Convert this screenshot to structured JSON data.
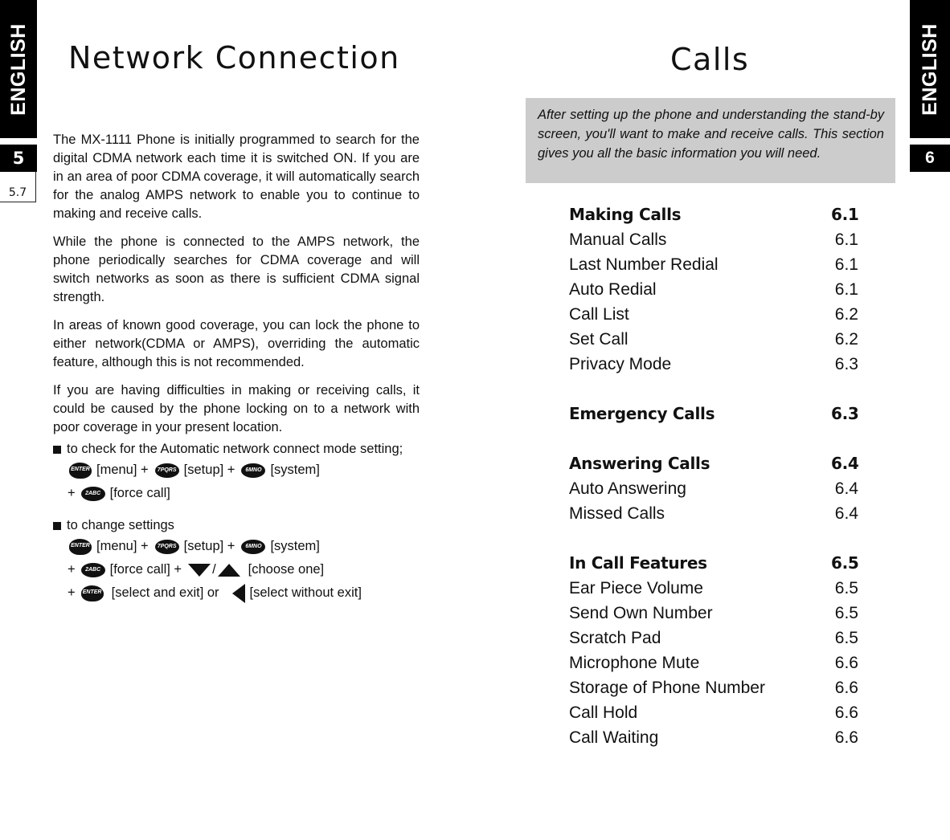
{
  "left_page": {
    "side_tab": {
      "language": "ENGLISH",
      "chapter": "5",
      "section": "5.7"
    },
    "title": "Network Connection",
    "paragraphs": [
      "The MX-1111 Phone is initially programmed to search for the digital CDMA network each time it is switched ON. If you are in an area of poor CDMA coverage, it will automatically search for the analog AMPS network to enable you to continue to making and receive calls.",
      "While the phone is connected to the AMPS network, the phone periodically searches for CDMA coverage and will switch networks as soon as there is sufficient CDMA signal strength.",
      "In areas of known good coverage, you can lock the phone to either network(CDMA or AMPS), overriding the automatic feature, although this is not recommended.",
      "If you are having difficulties in making or receiving calls, it could be caused by the phone locking on to a network with poor coverage in your present location."
    ],
    "check_mode": {
      "bullet": "to check for the Automatic network connect mode setting;",
      "keys": {
        "enter": "ENTER",
        "menu": "[menu] +",
        "seven": "7PQRS",
        "setup": "[setup] +",
        "six": "6MNO",
        "system": "[system]",
        "plus": "+",
        "two": "2ABC",
        "force_call": "[force call]"
      }
    },
    "change_settings": {
      "bullet": "to change settings",
      "keys": {
        "enter": "ENTER",
        "menu": "[menu] +",
        "seven": "7PQRS",
        "setup": "[setup] +",
        "six": "6MNO",
        "system": "[system]",
        "plus": "+",
        "two": "2ABC",
        "force_call": "[force call] +",
        "slash": "/",
        "choose_one": "[choose one]",
        "select_exit": "[select and exit] or",
        "select_no_exit": "[select without exit]"
      }
    }
  },
  "right_page": {
    "side_tab": {
      "language": "ENGLISH",
      "chapter": "6"
    },
    "title": "Calls",
    "intro": "After setting up the phone and understanding the stand-by screen, you'll want to make and receive calls. This section gives you all the basic information you will need.",
    "toc": [
      {
        "heading": {
          "label": "Making Calls",
          "num": "6.1"
        },
        "items": [
          {
            "label": "Manual Calls",
            "num": "6.1"
          },
          {
            "label": "Last Number Redial",
            "num": "6.1"
          },
          {
            "label": "Auto Redial",
            "num": "6.1"
          },
          {
            "label": "Call List",
            "num": "6.2"
          },
          {
            "label": "Set Call",
            "num": "6.2"
          },
          {
            "label": "Privacy Mode",
            "num": "6.3"
          }
        ]
      },
      {
        "heading": {
          "label": "Emergency Calls",
          "num": "6.3"
        },
        "items": []
      },
      {
        "heading": {
          "label": "Answering Calls",
          "num": "6.4"
        },
        "items": [
          {
            "label": "Auto Answering",
            "num": "6.4"
          },
          {
            "label": "Missed Calls",
            "num": "6.4"
          }
        ]
      },
      {
        "heading": {
          "label": "In Call Features",
          "num": "6.5"
        },
        "items": [
          {
            "label": "Ear Piece Volume",
            "num": "6.5"
          },
          {
            "label": "Send Own Number",
            "num": "6.5"
          },
          {
            "label": "Scratch Pad",
            "num": "6.5"
          },
          {
            "label": "Microphone Mute",
            "num": "6.6"
          },
          {
            "label": "Storage of Phone Number",
            "num": "6.6"
          },
          {
            "label": "Call Hold",
            "num": "6.6"
          },
          {
            "label": "Call Waiting",
            "num": "6.6"
          }
        ]
      }
    ]
  }
}
